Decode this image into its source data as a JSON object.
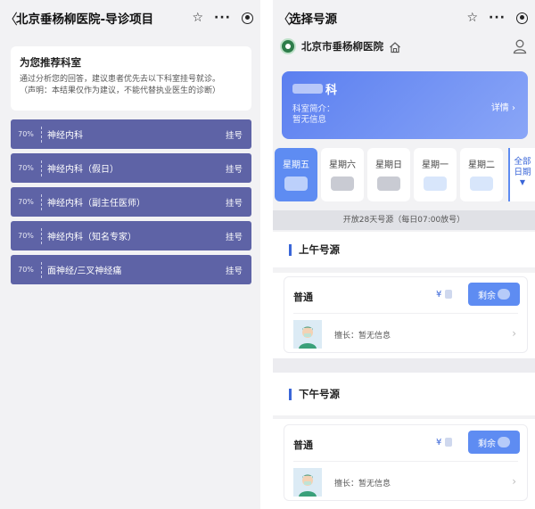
{
  "left": {
    "nav": {
      "title": "北京垂杨柳医院-导诊项目"
    },
    "recommend": {
      "title": "为您推荐科室",
      "desc_line1": "通过分析您的回答，建议患者优先去以下科室挂号就诊。",
      "desc_line2": "（声明：本结果仅作为建议，不能代替执业医生的诊断）"
    },
    "departments": [
      {
        "pct": "70%",
        "name": "神经内科",
        "button": "挂号"
      },
      {
        "pct": "70%",
        "name": "神经内科（假日）",
        "button": "挂号"
      },
      {
        "pct": "70%",
        "name": "神经内科（副主任医师）",
        "button": "挂号"
      },
      {
        "pct": "70%",
        "name": "神经内科（知名专家）",
        "button": "挂号"
      },
      {
        "pct": "70%",
        "name": "面神经/三叉神经痛",
        "button": "挂号"
      }
    ]
  },
  "right": {
    "nav": {
      "title": "选择号源"
    },
    "hospital": {
      "name": "北京市垂杨柳医院"
    },
    "dept_card": {
      "name_suffix": "科",
      "intro_label": "科室简介：",
      "intro_value": "暂无信息",
      "detail_label": "详情"
    },
    "dates": [
      {
        "day": "星期五",
        "active": true
      },
      {
        "day": "星期六",
        "active": false
      },
      {
        "day": "星期日",
        "active": false
      },
      {
        "day": "星期一",
        "active": false
      },
      {
        "day": "星期二",
        "active": false
      }
    ],
    "all_dates": {
      "line1": "全部",
      "line2": "日期"
    },
    "notice": "开放28天号源（每日07:00放号）",
    "sections": [
      {
        "title": "上午号源",
        "slot_type": "普通",
        "price_prefix": "¥",
        "button_label": "剩余",
        "doctor_info": "擅长：暂无信息"
      },
      {
        "title": "下午号源",
        "slot_type": "普通",
        "price_prefix": "¥",
        "button_label": "剩余",
        "doctor_info": "擅长：暂无信息"
      }
    ]
  },
  "colors": {
    "dept_item_bg": "#5e63a6",
    "accent_blue": "#5e8cf2",
    "section_bar": "#3a66d8"
  }
}
